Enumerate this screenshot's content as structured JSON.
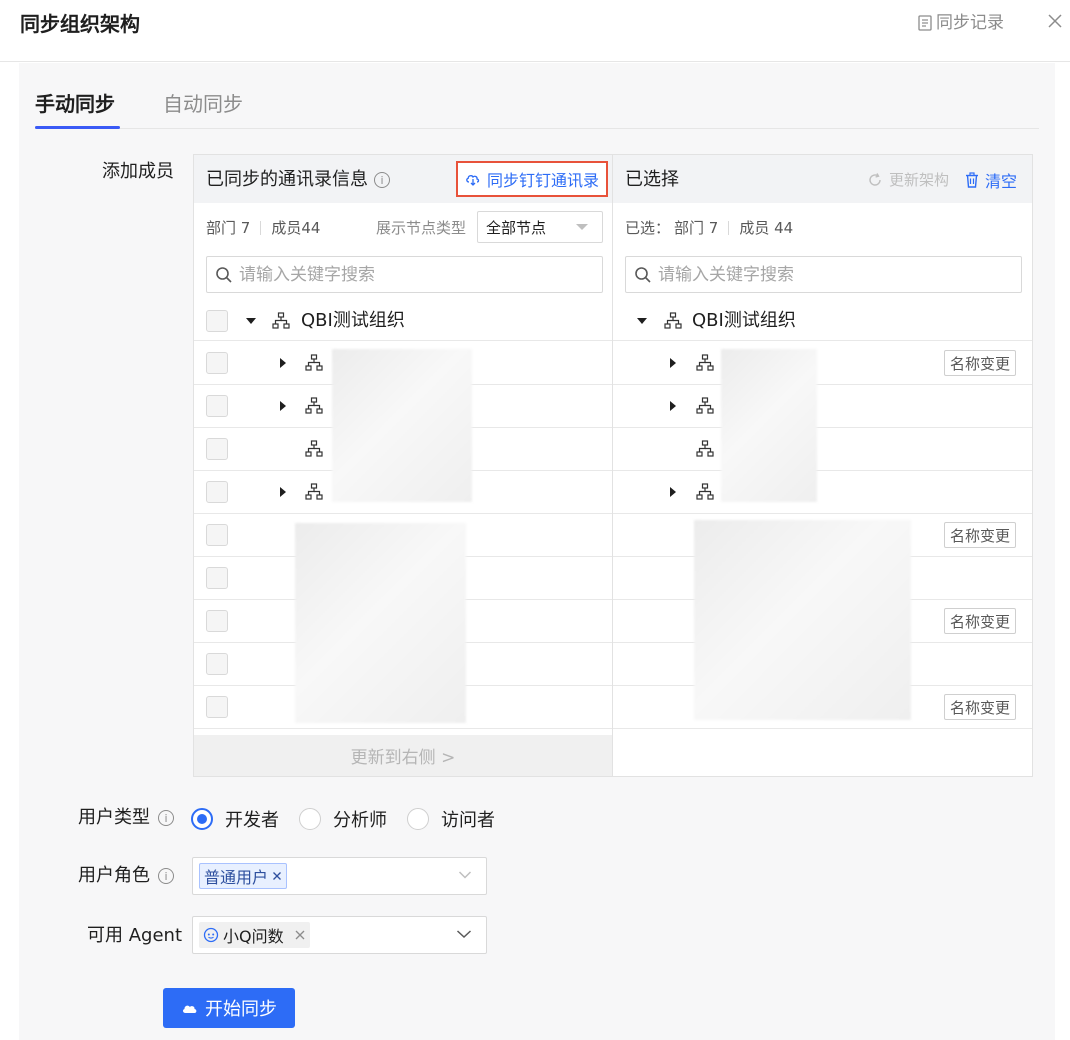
{
  "header": {
    "title": "同步组织架构",
    "history_label": "同步记录"
  },
  "tabs": [
    {
      "label": "手动同步",
      "active": true
    },
    {
      "label": "自动同步",
      "active": false
    }
  ],
  "add_members_label": "添加成员",
  "left_panel": {
    "title": "已同步的通讯录信息",
    "sync_button": "同步钉钉通讯录",
    "dept_stat": "部门 7",
    "member_stat": "成员44",
    "node_type_label": "展示节点类型",
    "node_type_value": "全部节点",
    "search_placeholder": "请输入关键字搜索",
    "root_name": "QBI测试组织",
    "move_button": "更新到右侧 >"
  },
  "right_panel": {
    "title": "已选择",
    "refresh_label": "更新架构",
    "clear_label": "清空",
    "selected_prefix": "已选：",
    "dept_stat": "部门 7",
    "member_stat": "成员 44",
    "search_placeholder": "请输入关键字搜索",
    "root_name": "QBI测试组织",
    "rename_tag": "名称变更"
  },
  "user_type": {
    "label": "用户类型",
    "options": [
      "开发者",
      "分析师",
      "访问者"
    ],
    "selected": "开发者"
  },
  "user_role": {
    "label": "用户角色",
    "chip": "普通用户"
  },
  "agent": {
    "label": "可用 Agent",
    "chip": "小Q问数"
  },
  "start_button": "开始同步",
  "colors": {
    "primary": "#2d6cf6",
    "highlight_border": "#e8523a",
    "tab_indicator": "#3a5af6"
  }
}
